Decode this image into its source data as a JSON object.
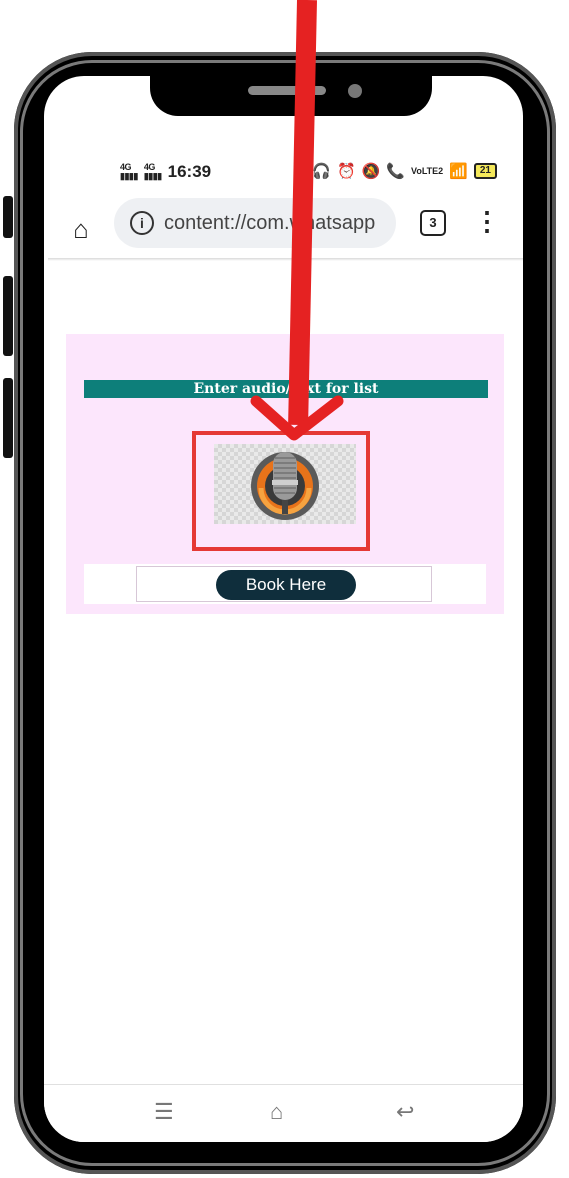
{
  "status_bar": {
    "signal_1": "4G",
    "signal_2": "4G",
    "time": "16:39",
    "volte": "VoLTE2",
    "battery": "21"
  },
  "browser": {
    "url": "content://com.whatsapp",
    "tab_count": "3"
  },
  "page": {
    "heading": "Enter audio/text for list",
    "book_button_label": "Book Here"
  },
  "colors": {
    "card_bg": "#fce6fc",
    "heading_band": "#0d7f7a",
    "book_button": "#0f2e3c",
    "highlight": "#e53935"
  }
}
